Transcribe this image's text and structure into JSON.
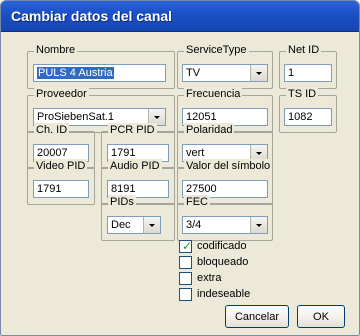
{
  "window": {
    "title": "Cambiar datos del canal"
  },
  "fields": {
    "nombre": {
      "label": "Nombre",
      "value": "PULS 4 Austria"
    },
    "service_type": {
      "label": "ServiceType",
      "value": "TV"
    },
    "net_id": {
      "label": "Net ID",
      "value": "1"
    },
    "proveedor": {
      "label": "Proveedor",
      "value": "ProSiebenSat.1"
    },
    "frecuencia": {
      "label": "Frecuencia",
      "value": "12051"
    },
    "ts_id": {
      "label": "TS ID",
      "value": "1082"
    },
    "ch_id": {
      "label": "Ch. ID",
      "value": "20007"
    },
    "pcr_pid": {
      "label": "PCR PID",
      "value": "1791"
    },
    "polaridad": {
      "label": "Polaridad",
      "value": "vert"
    },
    "video_pid": {
      "label": "Video PID",
      "value": "1791"
    },
    "audio_pid": {
      "label": "Audio PID",
      "value": "8191"
    },
    "valor_simbolo": {
      "label": "Valor del símbolo",
      "value": "27500"
    },
    "pids": {
      "label": "PIDs",
      "value": "Dec"
    },
    "fec": {
      "label": "FEC",
      "value": "3/4"
    }
  },
  "flags": [
    {
      "label": "codificado",
      "checked": true
    },
    {
      "label": "bloqueado",
      "checked": false
    },
    {
      "label": "extra",
      "checked": false
    },
    {
      "label": "indeseable",
      "checked": false
    }
  ],
  "buttons": {
    "cancel": "Cancelar",
    "ok": "OK"
  },
  "glyphs": {
    "check_mark": "✓"
  },
  "colors": {
    "title_bar": "#1b4fc4",
    "dialog_bg": "#ece9d8",
    "selection": "#316ac5"
  }
}
